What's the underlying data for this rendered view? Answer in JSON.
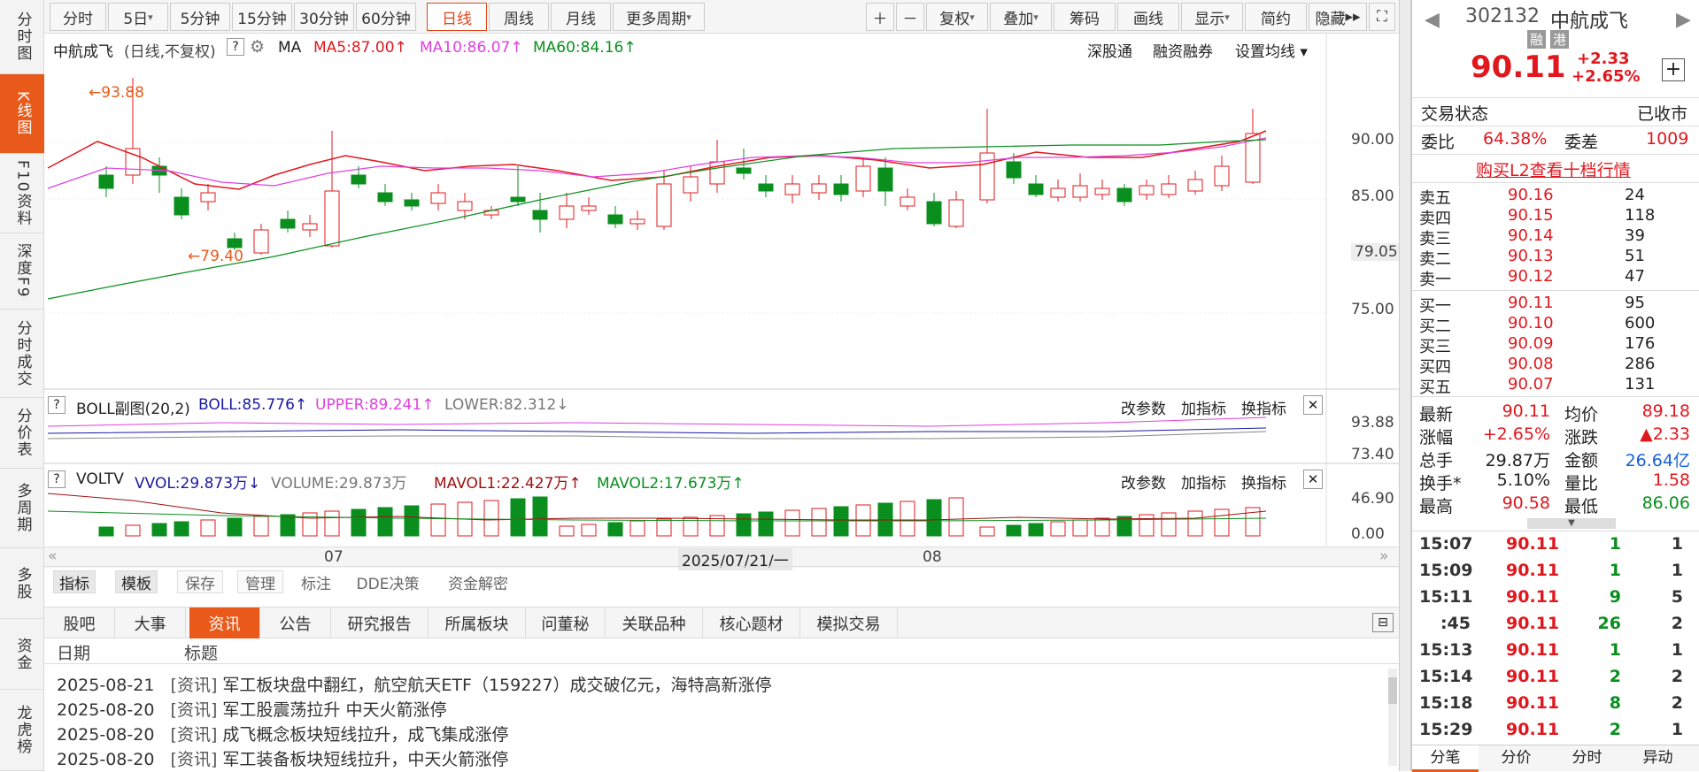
{
  "nav": [
    "分时图",
    "K线图",
    "F10资料",
    "深度F9",
    "分时成交",
    "分价表",
    "多周期",
    "多股",
    "资金",
    "龙虎榜"
  ],
  "toolbar": {
    "periods": [
      "分时",
      "5日",
      "5分钟",
      "15分钟",
      "30分钟",
      "60分钟",
      "日线",
      "周线",
      "月线",
      "更多周期"
    ],
    "tools": [
      "复权",
      "叠加",
      "筹码",
      "画线",
      "显示",
      "简约",
      "隐藏"
    ]
  },
  "chart": {
    "legend": {
      "name": "中航成飞",
      "mode": "(日线,不复权)",
      "help": "?",
      "ma": "MA",
      "ma5": "MA5:87.00",
      "ma10": "MA10:86.07",
      "ma60": "MA60:84.16"
    },
    "links": [
      "深股通",
      "融资融券",
      "设置均线"
    ],
    "high_label": "93.88",
    "low_label": "79.40",
    "price_axis": [
      "90.00",
      "85.00",
      "79.05",
      "75.00"
    ],
    "boll": {
      "title": "BOLL副图(20,2)",
      "boll": "BOLL:85.776",
      "upper": "UPPER:89.241",
      "lower": "LOWER:82.312",
      "axis": [
        "93.88",
        "73.40"
      ]
    },
    "vol": {
      "title": "VOLTV",
      "vvol": "VVOL:29.873万",
      "volume": "VOLUME:29.873万",
      "mavol1": "MAVOL1:22.427万",
      "mavol2": "MAVOL2:17.673万",
      "axis": [
        "46.90",
        "0.00"
      ]
    },
    "sub_actions": [
      "改参数",
      "加指标",
      "换指标"
    ],
    "dates": {
      "m1": "07",
      "m2": "08",
      "cursor": "2025/07/21/一"
    },
    "colors": {
      "up": "#e0181e",
      "down": "#0a8f1f",
      "ma5": "#e0181e",
      "ma10": "#e040e0",
      "ma60": "#0a8f1f"
    }
  },
  "bottom_tools": [
    "指标",
    "模板",
    "保存",
    "管理",
    "标注",
    "DDE决策",
    "资金解密"
  ],
  "tabs": [
    "股吧",
    "大事",
    "资讯",
    "公告",
    "研究报告",
    "所属板块",
    "问董秘",
    "关联品种",
    "核心题材",
    "模拟交易"
  ],
  "news": {
    "h_date": "日期",
    "h_title": "标题",
    "rows": [
      {
        "date": "2025-08-21",
        "tag": "[资讯]",
        "title": "军工板块盘中翻红，航空航天ETF（159227）成交破亿元，海特高新涨停"
      },
      {
        "date": "2025-08-20",
        "tag": "[资讯]",
        "title": "军工股震荡拉升 中天火箭涨停"
      },
      {
        "date": "2025-08-20",
        "tag": "[资讯]",
        "title": "成飞概念板块短线拉升，成飞集成涨停"
      },
      {
        "date": "2025-08-20",
        "tag": "[资讯]",
        "title": "军工装备板块短线拉升，中天火箭涨停"
      }
    ]
  },
  "quote": {
    "code": "302132",
    "name": "中航成飞",
    "tags": [
      "融",
      "港"
    ],
    "price": "90.11",
    "change": "+2.33",
    "pct": "+2.65%",
    "status_label": "交易状态",
    "status": "已收市",
    "weibi_label": "委比",
    "weibi": "64.38%",
    "weicha_label": "委差",
    "weicha": "1009",
    "l2": "购买L2查看十档行情",
    "asks": [
      {
        "l": "卖五",
        "p": "90.16",
        "v": "24"
      },
      {
        "l": "卖四",
        "p": "90.15",
        "v": "118"
      },
      {
        "l": "卖三",
        "p": "90.14",
        "v": "39"
      },
      {
        "l": "卖二",
        "p": "90.13",
        "v": "51"
      },
      {
        "l": "卖一",
        "p": "90.12",
        "v": "47"
      }
    ],
    "bids": [
      {
        "l": "买一",
        "p": "90.11",
        "v": "95"
      },
      {
        "l": "买二",
        "p": "90.10",
        "v": "600"
      },
      {
        "l": "买三",
        "p": "90.09",
        "v": "176"
      },
      {
        "l": "买四",
        "p": "90.08",
        "v": "286"
      },
      {
        "l": "买五",
        "p": "90.07",
        "v": "131"
      }
    ],
    "stats": [
      [
        {
          "l": "最新",
          "v": "90.11",
          "c": "red"
        },
        {
          "l": "均价",
          "v": "89.18",
          "c": "red"
        }
      ],
      [
        {
          "l": "涨幅",
          "v": "+2.65%",
          "c": "red"
        },
        {
          "l": "涨跌",
          "v": "▲2.33",
          "c": "red"
        }
      ],
      [
        {
          "l": "总手",
          "v": "29.87万",
          "c": ""
        },
        {
          "l": "金额",
          "v": "26.64亿",
          "c": "blue"
        }
      ],
      [
        {
          "l": "换手*",
          "v": "5.10%",
          "c": ""
        },
        {
          "l": "量比",
          "v": "1.58",
          "c": "red"
        }
      ],
      [
        {
          "l": "最高",
          "v": "90.58",
          "c": "red"
        },
        {
          "l": "最低",
          "v": "86.06",
          "c": "green"
        }
      ]
    ],
    "ticks": [
      {
        "t": "15:07",
        "p": "90.11",
        "v": "1",
        "n": "1",
        "c": "green"
      },
      {
        "t": "15:09",
        "p": "90.11",
        "v": "1",
        "n": "1",
        "c": "green"
      },
      {
        "t": "15:11",
        "p": "90.11",
        "v": "9",
        "n": "5",
        "c": "green"
      },
      {
        "t": ":45",
        "p": "90.11",
        "v": "26",
        "n": "2",
        "c": "green"
      },
      {
        "t": "15:13",
        "p": "90.11",
        "v": "1",
        "n": "1",
        "c": "green"
      },
      {
        "t": "15:14",
        "p": "90.11",
        "v": "2",
        "n": "2",
        "c": "green"
      },
      {
        "t": "15:18",
        "p": "90.11",
        "v": "8",
        "n": "2",
        "c": "green"
      },
      {
        "t": "15:29",
        "p": "90.11",
        "v": "2",
        "n": "1",
        "c": "green"
      }
    ],
    "bottom_tabs": [
      "分笔",
      "分价",
      "分时",
      "异动"
    ]
  }
}
